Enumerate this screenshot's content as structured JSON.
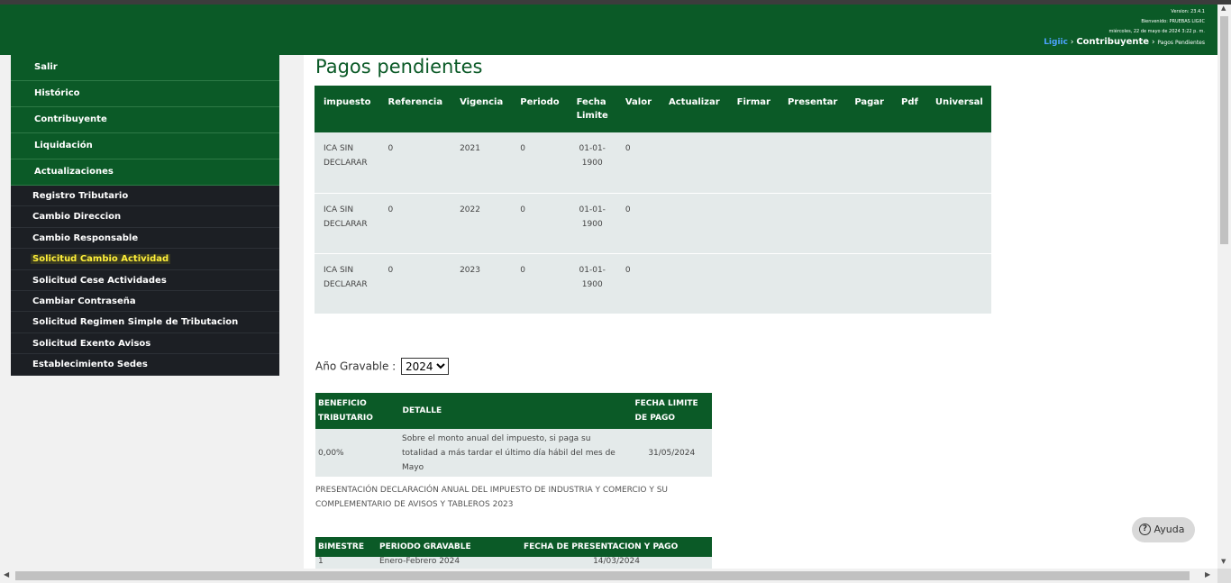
{
  "header": {
    "version": "Version: 23.4.1",
    "welcome": "Bienvenido: PRUEBAS LIGIIC",
    "datetime": "miércoles, 22 de mayo de 2024 3:22 p. m.",
    "breadcrumb": {
      "root": "Ligiic",
      "section": "Contribuyente",
      "page": "Pagos Pendientes",
      "sep": "›"
    }
  },
  "sidebar": {
    "items": [
      {
        "label": "Salir"
      },
      {
        "label": "Histórico"
      },
      {
        "label": "Contribuyente"
      },
      {
        "label": "Liquidación"
      },
      {
        "label": "Actualizaciones"
      }
    ],
    "subitems": [
      {
        "label": "Registro Tributario"
      },
      {
        "label": "Cambio Direccion"
      },
      {
        "label": "Cambio Responsable"
      },
      {
        "label": "Solicitud Cambio Actividad"
      },
      {
        "label": "Solicitud Cese Actividades"
      },
      {
        "label": "Cambiar Contraseña"
      },
      {
        "label": "Solicitud Regimen Simple de Tributacion"
      },
      {
        "label": "Solicitud Exento Avisos"
      },
      {
        "label": "Establecimiento Sedes"
      }
    ],
    "active_subitem": "Solicitud Cambio Actividad"
  },
  "main": {
    "title": "Pagos pendientes",
    "pagos_table": {
      "headers": [
        "impuesto",
        "Referencia",
        "Vigencia",
        "Periodo",
        "Fecha Limite",
        "Valor",
        "Actualizar",
        "Firmar",
        "Presentar",
        "Pagar",
        "Pdf",
        "Universal"
      ],
      "rows": [
        [
          "ICA SIN DECLARAR",
          "0",
          "2021",
          "0",
          "01-01-1900",
          "0",
          "",
          "",
          "",
          "",
          "",
          ""
        ],
        [
          "ICA SIN DECLARAR",
          "0",
          "2022",
          "0",
          "01-01-1900",
          "0",
          "",
          "",
          "",
          "",
          "",
          ""
        ],
        [
          "ICA SIN DECLARAR",
          "0",
          "2023",
          "0",
          "01-01-1900",
          "0",
          "",
          "",
          "",
          "",
          "",
          ""
        ]
      ]
    },
    "anio_gravable": {
      "label": "Año Gravable :",
      "selected": "2024"
    },
    "beneficio_table": {
      "headers": [
        "BENEFICIO TRIBUTARIO",
        "DETALLE",
        "FECHA LIMITE DE PAGO"
      ],
      "rows": [
        [
          "0,00%",
          "Sobre el monto anual del impuesto, si paga su totalidad a más tardar el último día hábil del mes de Mayo",
          "31/05/2024"
        ]
      ]
    },
    "presentacion_text": "PRESENTACIÓN DECLARACIÓN ANUAL DEL IMPUESTO DE INDUSTRIA Y COMERCIO Y SU COMPLEMENTARIO DE AVISOS Y TABLEROS 2023",
    "bimestre_table": {
      "headers": [
        "BIMESTRE",
        "PERIODO GRAVABLE",
        "FECHA DE PRESENTACION Y PAGO"
      ],
      "rows": [
        [
          "1",
          "Enero-Febrero 2024",
          "14/03/2024"
        ]
      ]
    }
  },
  "help_button": {
    "label": "Ayuda",
    "icon": "question-circle-icon"
  },
  "colors": {
    "brand_green": "#0b5a27",
    "sidebar_dark": "#1c1f24",
    "active_yellow": "#ffef3a",
    "link_blue": "#4da3ff"
  }
}
